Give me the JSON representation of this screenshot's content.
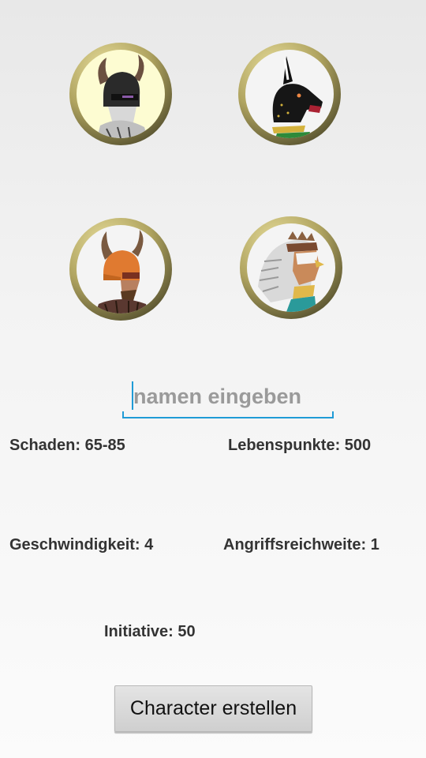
{
  "characters": [
    {
      "icon": "horned-knight-helmet-icon",
      "selected": true
    },
    {
      "icon": "anubis-jackal-icon",
      "selected": false
    },
    {
      "icon": "viking-warrior-icon",
      "selected": false
    },
    {
      "icon": "eagle-headdress-warrior-icon",
      "selected": false
    }
  ],
  "name_input": {
    "value": "",
    "placeholder": "namen eingeben"
  },
  "stats": {
    "schaden": "Schaden: 65-85",
    "lebenspunkte": "Lebenspunkte: 500",
    "geschwindigkeit": "Geschwindigkeit: 4",
    "angriffsreichweite": "Angriffsreichweite: 1",
    "initiative": "Initiative: 50"
  },
  "create_button": {
    "label": "Character erstellen"
  },
  "colors": {
    "accent": "#1f9bd6",
    "portrait_ring": "#b0a460",
    "text": "#333333"
  }
}
